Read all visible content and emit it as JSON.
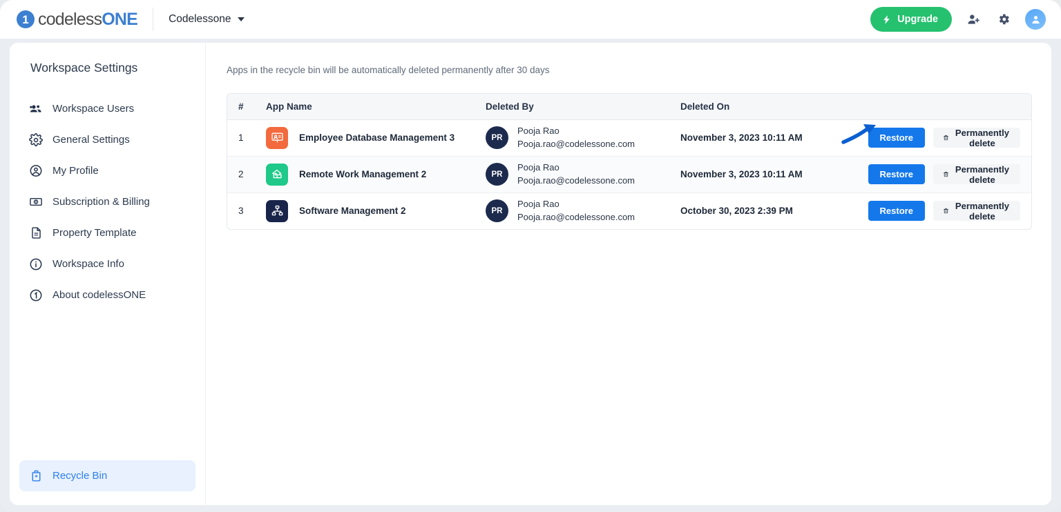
{
  "header": {
    "logo_primary": "codeless",
    "logo_accent": "ONE",
    "logo_mark": "1",
    "workspace_name": "Codelessone",
    "upgrade_label": "Upgrade",
    "icons": {
      "bolt": "bolt-icon",
      "add_user": "add-user-icon",
      "settings": "gear-icon",
      "avatar": "user-avatar-icon",
      "caret": "chevron-down-icon"
    }
  },
  "sidebar": {
    "title": "Workspace Settings",
    "items": [
      {
        "label": "Workspace Users",
        "icon": "users-icon",
        "active": false
      },
      {
        "label": "General Settings",
        "icon": "gear-icon",
        "active": false
      },
      {
        "label": "My Profile",
        "icon": "user-circle-icon",
        "active": false
      },
      {
        "label": "Subscription & Billing",
        "icon": "banknote-icon",
        "active": false
      },
      {
        "label": "Property Template",
        "icon": "document-icon",
        "active": false
      },
      {
        "label": "Workspace Info",
        "icon": "info-circle-icon",
        "active": false
      },
      {
        "label": "About codelessONE",
        "icon": "about-logo-icon",
        "active": false
      }
    ],
    "bottom_item": {
      "label": "Recycle Bin",
      "icon": "recycle-bin-icon",
      "active": true
    }
  },
  "main": {
    "notice": "Apps in the recycle bin will be automatically deleted permanently after 30 days",
    "columns": [
      "#",
      "App Name",
      "Deleted By",
      "Deleted On",
      ""
    ],
    "rows": [
      {
        "index": "1",
        "app_name": "Employee Database Management 3",
        "app_icon": "employee-database-app-icon",
        "app_icon_color": "#f26a3d",
        "deleted_by_initials": "PR",
        "deleted_by_name": "Pooja Rao",
        "deleted_by_email": "Pooja.rao@codelessone.com",
        "deleted_on": "November 3, 2023 10:11 AM",
        "restore_label": "Restore",
        "delete_label": "Permanently delete"
      },
      {
        "index": "2",
        "app_name": "Remote Work Management 2",
        "app_icon": "remote-work-app-icon",
        "app_icon_color": "#1fc98a",
        "deleted_by_initials": "PR",
        "deleted_by_name": "Pooja Rao",
        "deleted_by_email": "Pooja.rao@codelessone.com",
        "deleted_on": "November 3, 2023 10:11 AM",
        "restore_label": "Restore",
        "delete_label": "Permanently delete"
      },
      {
        "index": "3",
        "app_name": "Software Management 2",
        "app_icon": "software-management-app-icon",
        "app_icon_color": "#18244a",
        "deleted_by_initials": "PR",
        "deleted_by_name": "Pooja Rao",
        "deleted_by_email": "Pooja.rao@codelessone.com",
        "deleted_on": "October 30, 2023 2:39 PM",
        "restore_label": "Restore",
        "delete_label": "Permanently delete"
      }
    ]
  },
  "annotation": {
    "name": "curved-arrow-to-restore",
    "color": "#0b5fd1"
  },
  "colors": {
    "accent_blue": "#1478eb",
    "upgrade_green": "#25c16f",
    "active_nav_blue": "#2f80ed",
    "avatar_navy": "#1c2a4d"
  }
}
